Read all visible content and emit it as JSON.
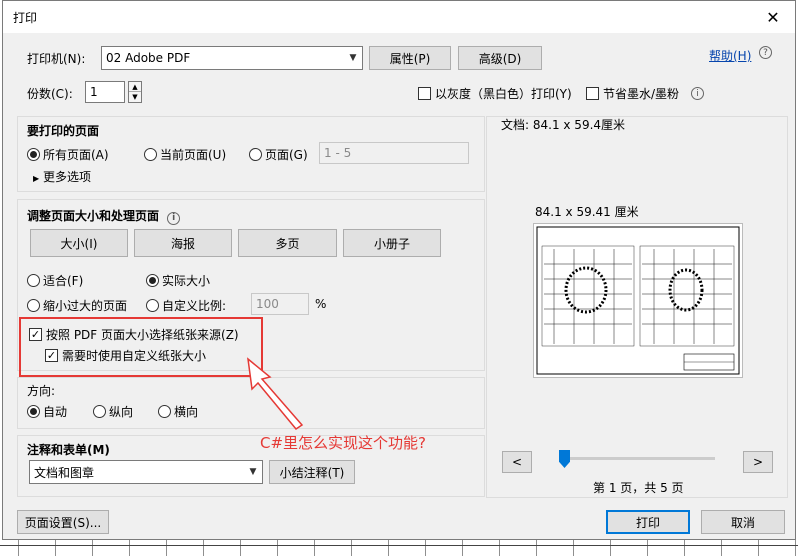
{
  "window": {
    "title": "打印",
    "close": "✕"
  },
  "printer": {
    "label": "打印机(N):",
    "value": "02  Adobe PDF",
    "properties": "属性(P)",
    "advanced": "高级(D)"
  },
  "help": {
    "label": "帮助(H)",
    "icon": "?"
  },
  "copies": {
    "label": "份数(C):",
    "value": "1"
  },
  "options": {
    "grayscale": "以灰度（黑白色）打印(Y)",
    "save_ink": "节省墨水/墨粉"
  },
  "pages": {
    "title": "要打印的页面",
    "all": "所有页面(A)",
    "current": "当前页面(U)",
    "range": "页面(G)",
    "range_value": "1 - 5",
    "more": "更多选项"
  },
  "sizing": {
    "title": "调整页面大小和处理页面",
    "tabs": [
      "大小(I)",
      "海报",
      "多页",
      "小册子"
    ],
    "fit": "适合(F)",
    "actual": "实际大小",
    "shrink": "缩小过大的页面",
    "custom": "自定义比例:",
    "custom_value": "100",
    "percent": "%",
    "by_pdf_size": "按照 PDF 页面大小选择纸张来源(Z)",
    "custom_paper": "需要时使用自定义纸张大小"
  },
  "orientation": {
    "title": "方向:",
    "auto": "自动",
    "portrait": "纵向",
    "landscape": "横向"
  },
  "comments": {
    "title": "注释和表单(M)",
    "value": "文档和图章",
    "summarize": "小结注释(T)"
  },
  "annotation": "C#里怎么实现这个功能?",
  "preview": {
    "doc_label": "文档:  84.1 x 59.4厘米",
    "size_label": "84.1 x 59.41 厘米",
    "prev": "<",
    "next": ">",
    "page_info": "第 1 页，共 5 页",
    "slider_position": 0
  },
  "footer": {
    "page_setup": "页面设置(S)...",
    "print": "打印",
    "cancel": "取消"
  }
}
